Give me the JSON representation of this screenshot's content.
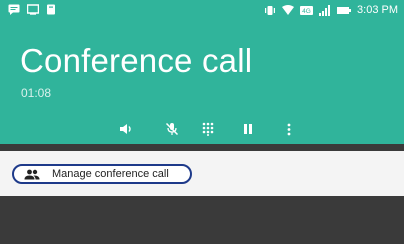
{
  "status_bar": {
    "time": "3:03 PM",
    "left_icons": [
      "chat-icon",
      "screen-icon",
      "notification-icon"
    ],
    "right_icons": [
      "vibrate-icon",
      "wifi-icon",
      "4g-icon",
      "signal-icon",
      "battery-icon"
    ],
    "network_label": "4G"
  },
  "call": {
    "title": "Conference call",
    "timer": "01:08"
  },
  "controls": [
    {
      "name": "speaker",
      "icon": "speaker-icon"
    },
    {
      "name": "mute",
      "icon": "mic-off-icon"
    },
    {
      "name": "dialpad",
      "icon": "dialpad-icon"
    },
    {
      "name": "hold",
      "icon": "pause-icon"
    },
    {
      "name": "more",
      "icon": "more-vert-icon"
    }
  ],
  "manage": {
    "label": "Manage conference call",
    "icon": "group-icon"
  },
  "colors": {
    "header": "#30b49b",
    "manage_bg": "#f4f4f4",
    "lower_bg": "#3a3a3a",
    "highlight_border": "#1e3a8a"
  }
}
